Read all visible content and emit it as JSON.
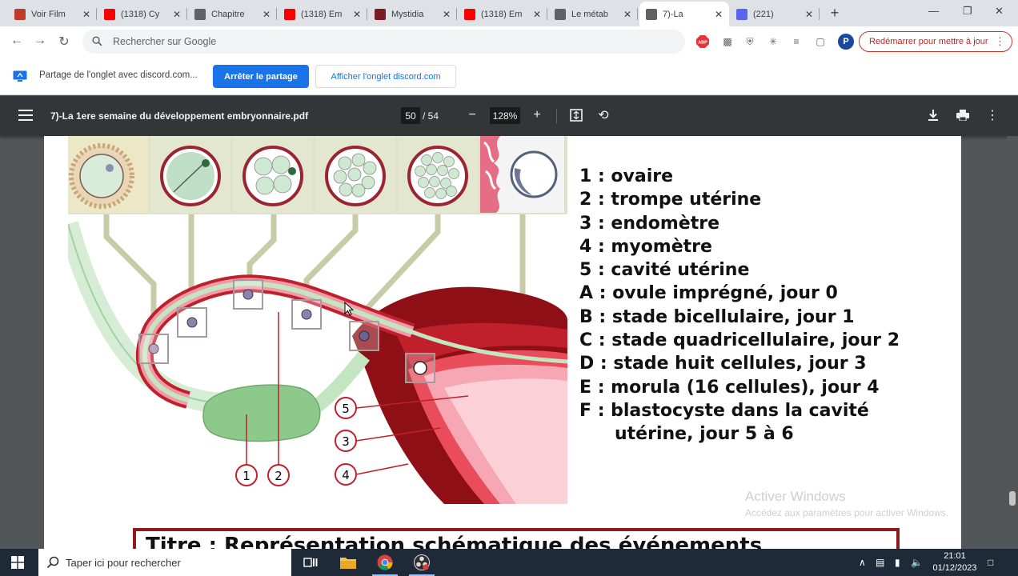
{
  "browser": {
    "tabs": [
      {
        "title": "Voir Film",
        "icon": "film-site-icon",
        "color": "#c0392b"
      },
      {
        "title": "(1318) Cy",
        "icon": "youtube-icon",
        "color": "#ff0000"
      },
      {
        "title": "Chapitre",
        "icon": "globe-icon",
        "color": "#5f6368"
      },
      {
        "title": "(1318) Em",
        "icon": "youtube-icon",
        "color": "#ff0000"
      },
      {
        "title": "Mystidia",
        "icon": "mystidia-icon",
        "color": "#7a1c24"
      },
      {
        "title": "(1318) Em",
        "icon": "youtube-icon",
        "color": "#ff0000"
      },
      {
        "title": "Le métab",
        "icon": "globe-icon",
        "color": "#5f6368"
      },
      {
        "title": "7)-La",
        "icon": "globe-icon",
        "color": "#5f6368",
        "active": true
      },
      {
        "title": "(221)",
        "icon": "discord-icon",
        "color": "#5865f2"
      }
    ],
    "omnibox_placeholder": "Rechercher sur Google",
    "restart_label": "Redémarrer pour mettre à jour",
    "avatar_letter": "P",
    "share_message": "Partage de l'onglet avec discord.com...",
    "stop_share_label": "Arrêter le partage",
    "show_tab_label": "Afficher l'onglet discord.com"
  },
  "pdf": {
    "title": "7)-La 1ere semaine du développement embryonnaire.pdf",
    "current_page": "50",
    "total_pages": "/ 54",
    "zoom": "128%"
  },
  "document": {
    "legend": [
      "1 : ovaire",
      "2 : trompe utérine",
      "3 : endomètre",
      "4 : myomètre",
      "5 : cavité utérine",
      "A : ovule imprégné, jour 0",
      "B : stade bicellulaire, jour 1",
      "C : stade quadricellulaire, jour 2",
      "D : stade huit cellules, jour 3",
      "E : morula (16 cellules), jour 4",
      "F : blastocyste dans la cavité"
    ],
    "legend_continuation": "utérine, jour 5 à 6",
    "figure_numbers": [
      "1",
      "2",
      "5",
      "3",
      "4"
    ],
    "title_partial": "Titre : Représentation schématique des événements"
  },
  "watermark": {
    "line1": "Activer Windows",
    "line2": "Accédez aux paramètres pour activer Windows."
  },
  "taskbar": {
    "search_placeholder": "Taper ici pour rechercher",
    "time": "21:01",
    "date": "01/12/2023"
  }
}
